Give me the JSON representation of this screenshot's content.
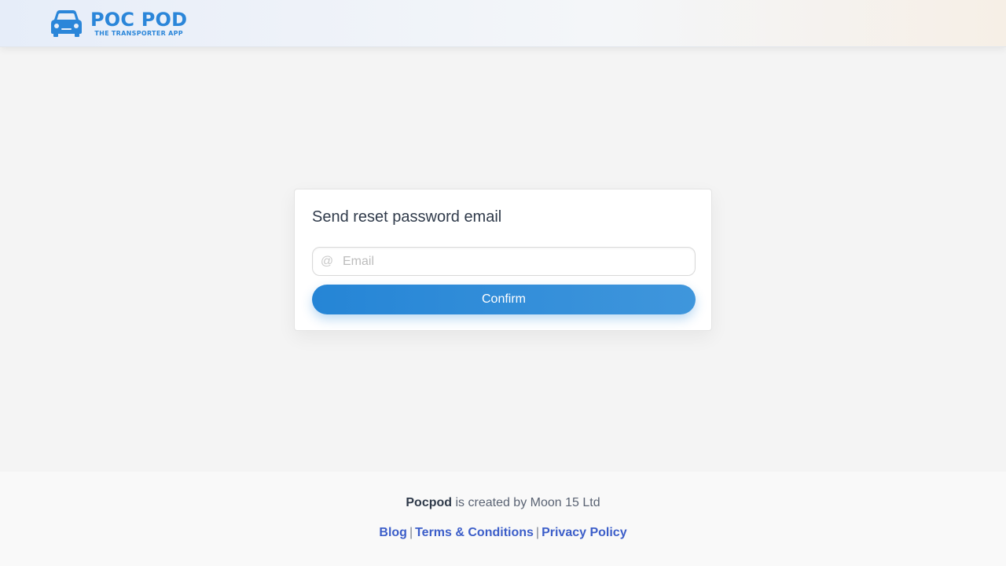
{
  "header": {
    "logo": {
      "icon": "car-icon",
      "title": "POC POD",
      "subtitle": "THE TRANSPORTER APP",
      "color": "#2b86d9"
    }
  },
  "reset_form": {
    "title": "Send reset password email",
    "email_icon": "at-icon",
    "email_symbol": "@",
    "email_value": "",
    "email_placeholder": "Email",
    "confirm_label": "Confirm",
    "button_color": "#2585d6"
  },
  "footer": {
    "brand": "Pocpod",
    "credit_text": " is created by Moon 15 Ltd",
    "separator": "|",
    "links": {
      "blog": "Blog",
      "terms": "Terms & Conditions",
      "privacy": "Privacy Policy"
    },
    "link_color": "#3c5ec9"
  }
}
